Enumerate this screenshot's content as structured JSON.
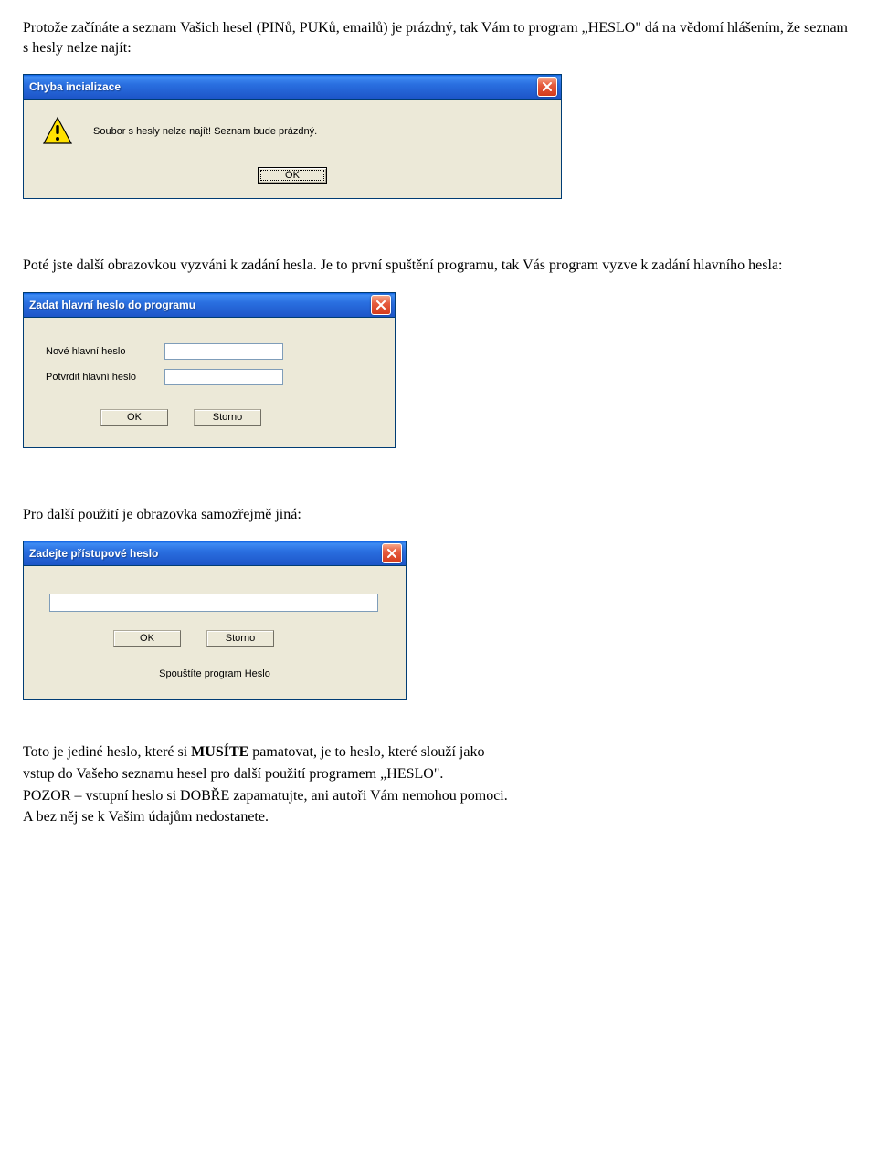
{
  "p1": "Protože začínáte a seznam Vašich  hesel (PINů, PUKů, emailů) je prázdný,  tak Vám to program „HESLO\" dá na vědomí  hlášením,  že seznam s hesly nelze najít:",
  "dialog1": {
    "title": "Chyba incializace",
    "message": "Soubor s hesly nelze najít! Seznam bude prázdný.",
    "ok_label": "OK"
  },
  "p2": "Poté jste další  obrazovkou vyzváni k zadání hesla. Je to první spuštění programu, tak Vás program vyzve k zadání hlavního hesla:",
  "dialog2": {
    "title": "Zadat hlavní heslo do programu",
    "label_new": "Nové hlavní heslo",
    "label_confirm": "Potvrdit hlavní heslo",
    "ok_label": "OK",
    "cancel_label": "Storno"
  },
  "p3": "Pro další použití je obrazovka samozřejmě jiná:",
  "dialog3": {
    "title": "Zadejte přístupové heslo",
    "ok_label": "OK",
    "cancel_label": "Storno",
    "status": "Spouštíte program Heslo"
  },
  "p4_a": "Toto je jediné heslo, které si ",
  "p4_b": "MUSÍTE",
  "p4_c": " pamatovat, je to heslo, které slouží jako",
  "p5": "vstup do Vašeho seznamu hesel pro další použití programem „HESLO\".",
  "p6": "POZOR – vstupní heslo si DOBŘE zapamatujte, ani autoři Vám nemohou pomoci.",
  "p7": "A bez něj se k Vašim údajům nedostanete."
}
